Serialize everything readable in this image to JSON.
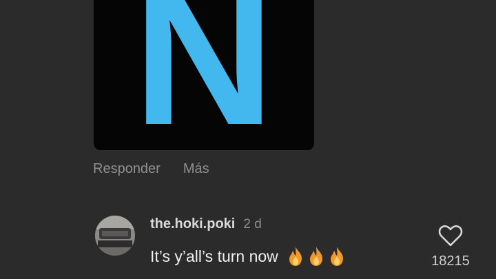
{
  "attachment": {
    "letter": "N",
    "letter_color": "#42b8ee"
  },
  "actions": {
    "reply_label": "Responder",
    "more_label": "Más"
  },
  "comment": {
    "username": "the.hoki.poki",
    "timestamp": "2 d",
    "text": "It’s y’all’s turn now",
    "emoji_icons": [
      "fire-icon",
      "fire-icon",
      "fire-icon"
    ],
    "like_count": "18215"
  },
  "colors": {
    "background": "#2b2b2c",
    "muted_text": "#8f8f8f",
    "fire": "#f2992e"
  }
}
